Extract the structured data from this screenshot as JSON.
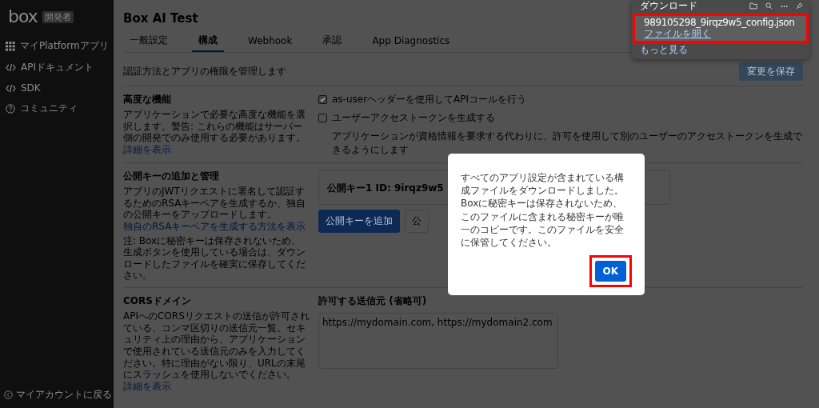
{
  "sidebar": {
    "logo": "box",
    "badge": "開発者",
    "items": [
      {
        "label": "マイPlatformアプリ",
        "kind": "grid"
      },
      {
        "label": "APIドキュメント",
        "kind": "code"
      },
      {
        "label": "SDK",
        "kind": "code"
      },
      {
        "label": "コミュニティ",
        "kind": "help"
      }
    ],
    "footer_link": "マイアカウントに戻る"
  },
  "header": {
    "title": "Box AI Test",
    "tabs": [
      {
        "label": "一般設定",
        "selected": false
      },
      {
        "label": "構成",
        "selected": true
      },
      {
        "label": "Webhook",
        "selected": false
      },
      {
        "label": "承認",
        "selected": false
      },
      {
        "label": "App Diagnostics",
        "selected": false
      }
    ],
    "description": "認証方法とアプリの権限を管理します",
    "save_button": "変更を保存"
  },
  "sections": [
    {
      "kind": "options",
      "title": "高度な機能",
      "description": "アプリケーションで必要な高度な機能を選択します。警告: これらの機能はサーバー側の開発でのみ使用する必要があります。",
      "link": "詳細を表示",
      "options": [
        {
          "label": "as-userヘッダーを使用してAPIコールを行う",
          "checked": true
        },
        {
          "label": "ユーザーアクセストークンを生成する",
          "checked": false,
          "hint": "アプリケーションが資格情報を要求する代わりに、許可を使用して別のユーザーのアクセストークンを生成できるようにします"
        }
      ]
    },
    {
      "kind": "keys",
      "title": "公開キーの追加と管理",
      "description": "アプリのJWTリクエストに署名して認証するためのRSAキーペアを生成するか、独自の公開キーをアップロードします。",
      "link": "独自のRSAキーペアを生成する方法を表示",
      "note": "注: Boxに秘密キーは保存されないため、生成ボタンを使用している場合は、ダウンロードしたファイルを確実に保存してください。",
      "key_label": "公開キー1 ID: 9irqz9w5",
      "buttons": [
        "公開キーを追加",
        "公"
      ]
    },
    {
      "kind": "cors",
      "title": "CORSドメイン",
      "description": "APIへのCORSリクエストの送信が許可されている、コンマ区切りの送信元一覧。セキュリティ上の理由から、アプリケーションで使用されている送信元のみを入力してください。特に理由がない限り、URLの末尾にスラッシュを使用しないでください。",
      "link": "詳細を表示",
      "field_label": "許可する送信元 (省略可)",
      "placeholder": "https://mydomain.com, https://mydomain2.com"
    }
  ],
  "modal": {
    "message": "すべてのアプリ設定が含まれている構成ファイルをダウンロードしました。Boxに秘密キーは保存されないため、このファイルに含まれる秘密キーが唯一のコピーです。このファイルを安全に保管してください。",
    "ok_button": "OK",
    "highlighted": true
  },
  "downloads": {
    "title": "ダウンロード",
    "file": {
      "name": "989105298_9irqz9w5_config.json",
      "action": "ファイルを開く",
      "highlighted": true
    },
    "more": "もっと見る"
  }
}
